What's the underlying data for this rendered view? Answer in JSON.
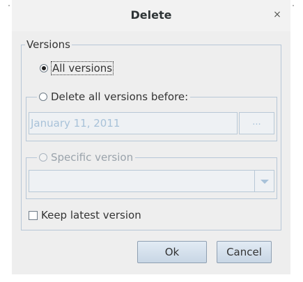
{
  "dialog": {
    "title": "Delete",
    "close_glyph": "×"
  },
  "versions_group": {
    "legend": "Versions",
    "all_versions": {
      "label": "All versions",
      "checked": true
    },
    "delete_before": {
      "label": "Delete all versions before:",
      "checked": false,
      "date_value": "January 11, 2011",
      "picker_label": "..."
    },
    "specific": {
      "label": "Specific version",
      "checked": false,
      "selected": ""
    },
    "keep_latest": {
      "label": "Keep latest version",
      "checked": false
    }
  },
  "buttons": {
    "ok": "Ok",
    "cancel": "Cancel"
  },
  "colors": {
    "dialog_bg": "#eeeeee",
    "group_border": "#b7c7d7",
    "disabled_text": "#a8c2d9",
    "button_gradient_top": "#e2ebf4",
    "button_gradient_bottom": "#c8d6e5"
  }
}
